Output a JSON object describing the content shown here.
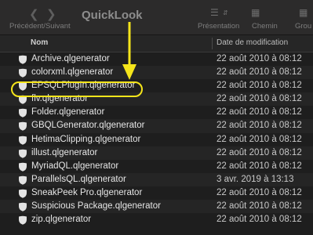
{
  "toolbar": {
    "title": "QuickLook",
    "back_forward_label": "Précédent/Suivant",
    "presentation_label": "Présentation",
    "path_label": "Chemin",
    "group_label": "Grou",
    "back_icon": "chevron-left-icon",
    "forward_icon": "chevron-right-icon"
  },
  "columns": {
    "name": "Nom",
    "date": "Date de modification"
  },
  "files": [
    {
      "name": "Archive.qlgenerator",
      "date": "22 août 2010 à 08:12"
    },
    {
      "name": "colorxml.qlgenerator",
      "date": "22 août 2010 à 08:12"
    },
    {
      "name": "EPSQLPlugIn.qlgenerator",
      "date": "22 août 2010 à 08:12"
    },
    {
      "name": "flv.qlgenerator",
      "date": "22 août 2010 à 08:12"
    },
    {
      "name": "Folder.qlgenerator",
      "date": "22 août 2010 à 08:12"
    },
    {
      "name": "GBQLGenerator.qlgenerator",
      "date": "22 août 2010 à 08:12"
    },
    {
      "name": "HetimaClipping.qlgenerator",
      "date": "22 août 2010 à 08:12"
    },
    {
      "name": "illust.qlgenerator",
      "date": "22 août 2010 à 08:12"
    },
    {
      "name": "MyriadQL.qlgenerator",
      "date": "22 août 2010 à 08:12"
    },
    {
      "name": "ParallelsQL.qlgenerator",
      "date": "3 avr. 2019 à 13:13"
    },
    {
      "name": "SneakPeek Pro.qlgenerator",
      "date": "22 août 2010 à 08:12"
    },
    {
      "name": "Suspicious Package.qlgenerator",
      "date": "22 août 2010 à 08:12"
    },
    {
      "name": "zip.qlgenerator",
      "date": "22 août 2010 à 08:12"
    }
  ],
  "annotation": {
    "highlight_color": "#f5e51b",
    "highlighted_file": "EPSQLPlugIn.qlgenerator"
  }
}
